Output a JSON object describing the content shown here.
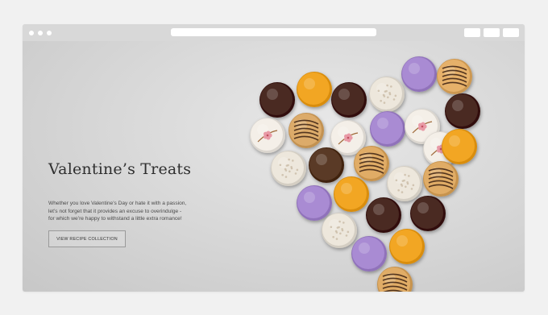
{
  "browser": {
    "window_dots": [
      "dot",
      "dot",
      "dot"
    ],
    "toolbar_buttons": [
      "button",
      "button",
      "button"
    ]
  },
  "hero": {
    "title": "Valentine’s Treats",
    "description_lines": [
      "Whether you love Valentine’s Day or hate it with a passion,",
      "let’s not forget that it provides an excuse to overindulge -",
      "for which we’re happy to withstand a little extra romance!"
    ],
    "cta_label": "VIEW RECIPE COLLECTION"
  },
  "macarons": [
    {
      "flavor": "chocolate",
      "color": "#4a2a22"
    },
    {
      "flavor": "mango",
      "color": "#f2a623"
    },
    {
      "flavor": "chocolate",
      "color": "#4a2a22"
    },
    {
      "flavor": "coconut",
      "color": "#ede7dc"
    },
    {
      "flavor": "lavender",
      "color": "#a98bd3"
    },
    {
      "flavor": "caramel-drizzle",
      "color": "#e6b16a"
    },
    {
      "flavor": "white-floral",
      "color": "#f4efe8"
    },
    {
      "flavor": "caramel-drizzle",
      "color": "#dcab6a"
    },
    {
      "flavor": "white-floral",
      "color": "#f4efe8"
    },
    {
      "flavor": "lavender",
      "color": "#a98bd3"
    },
    {
      "flavor": "white-floral",
      "color": "#f4efe8"
    },
    {
      "flavor": "chocolate",
      "color": "#4a2a22"
    },
    {
      "flavor": "coconut",
      "color": "#ede7dc"
    },
    {
      "flavor": "chocolate",
      "color": "#5a3a26"
    },
    {
      "flavor": "caramel-drizzle",
      "color": "#e0ac66"
    },
    {
      "flavor": "coconut",
      "color": "#ede7dc"
    },
    {
      "flavor": "white-floral",
      "color": "#f4efe8"
    },
    {
      "flavor": "mango",
      "color": "#f2a623"
    },
    {
      "flavor": "lavender",
      "color": "#a98bd3"
    },
    {
      "flavor": "mango",
      "color": "#f2a623"
    },
    {
      "flavor": "chocolate",
      "color": "#4a2a22"
    },
    {
      "flavor": "chocolate",
      "color": "#4a2a22"
    },
    {
      "flavor": "caramel-drizzle",
      "color": "#e0ac66"
    },
    {
      "flavor": "coconut",
      "color": "#ede7dc"
    },
    {
      "flavor": "lavender",
      "color": "#a98bd3"
    },
    {
      "flavor": "mango",
      "color": "#f2a623"
    },
    {
      "flavor": "caramel-drizzle",
      "color": "#e0ac66"
    }
  ]
}
